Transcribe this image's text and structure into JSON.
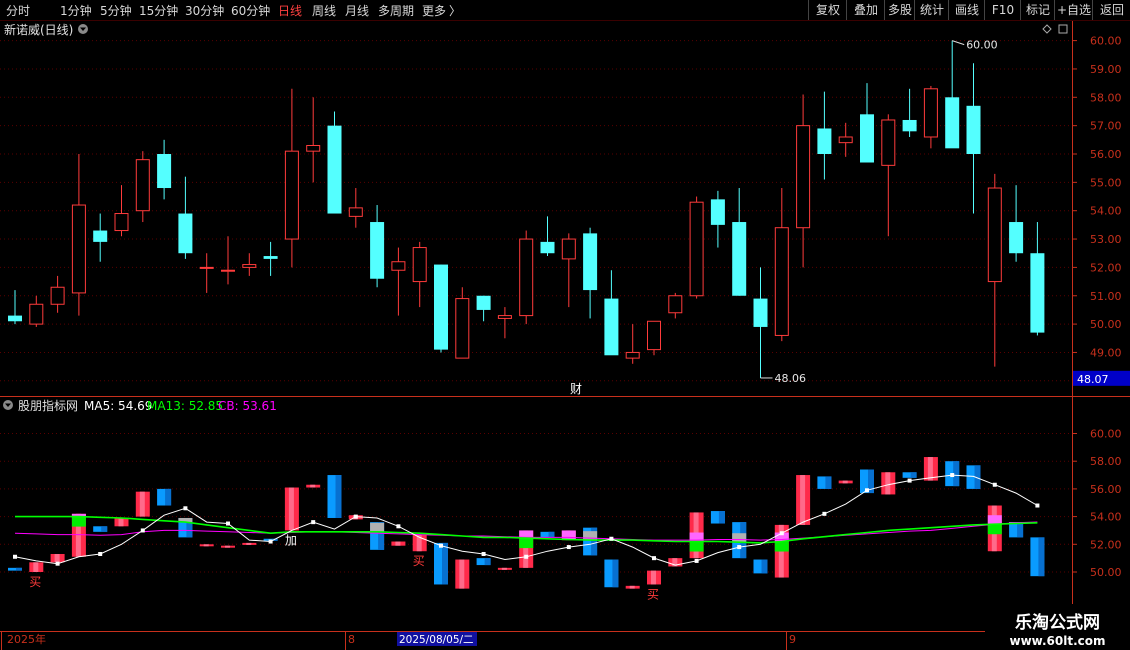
{
  "toolbar": {
    "periods": [
      "分时",
      "1分钟",
      "5分钟",
      "15分钟",
      "30分钟",
      "60分钟",
      "日线",
      "周线",
      "月线",
      "多周期",
      "更多"
    ],
    "active_period": "日线",
    "more_arrow": "〉",
    "right_buttons": [
      "复权",
      "叠加",
      "多股",
      "统计",
      "画线",
      "F10",
      "标记",
      "+自选",
      "返回"
    ]
  },
  "main_chart": {
    "title": "新诺威(日线)",
    "price_ticks": [
      "60.00",
      "59.00",
      "58.00",
      "57.00",
      "56.00",
      "55.00",
      "54.00",
      "53.00",
      "52.00",
      "51.00",
      "50.00",
      "49.00",
      "48.00"
    ],
    "current_price": "48.07",
    "max_label": "60.00",
    "min_label": "48.06",
    "event_marker": "财",
    "colors": {
      "up": "#ff3b3b",
      "down": "#54ffff",
      "grid": "#5a0000",
      "axis": "#c8301c"
    }
  },
  "indicator": {
    "name": "股朋指标网",
    "ma5_label": "MA5: 54.69",
    "ma13_label": "MA13: 52.85",
    "cb_label": "CB: 53.61",
    "ticks": [
      "60.00",
      "58.00",
      "56.00",
      "54.00",
      "52.00",
      "50.00"
    ],
    "signals": [
      {
        "text": "买",
        "i": 1
      },
      {
        "text": "加",
        "i": 13
      },
      {
        "text": "买",
        "i": 19
      },
      {
        "text": "买",
        "i": 30
      }
    ],
    "colors": {
      "ma5": "#ffffff",
      "ma13": "#00ff00",
      "cb": "#ff00ff",
      "red": "#ff2a4a",
      "blue": "#0a9bff"
    }
  },
  "time_axis": {
    "labels": [
      "2025年",
      "8",
      "2025/08/05/二",
      "9"
    ]
  },
  "watermark": {
    "title": "乐淘公式网",
    "url": "www.60lt.com"
  },
  "chart_data": {
    "type": "candlestick",
    "ylim": [
      47.6,
      60.6
    ],
    "candles": [
      {
        "o": 50.3,
        "h": 51.2,
        "l": 50.0,
        "c": 50.1
      },
      {
        "o": 50.0,
        "h": 51.0,
        "l": 49.9,
        "c": 50.7
      },
      {
        "o": 50.7,
        "h": 51.7,
        "l": 50.4,
        "c": 51.3
      },
      {
        "o": 51.1,
        "h": 56.0,
        "l": 50.3,
        "c": 54.2
      },
      {
        "o": 53.3,
        "h": 53.9,
        "l": 52.2,
        "c": 52.9
      },
      {
        "o": 53.3,
        "h": 54.9,
        "l": 53.1,
        "c": 53.9
      },
      {
        "o": 54.0,
        "h": 56.1,
        "l": 53.6,
        "c": 55.8
      },
      {
        "o": 56.0,
        "h": 56.5,
        "l": 54.4,
        "c": 54.8
      },
      {
        "o": 53.9,
        "h": 55.2,
        "l": 52.3,
        "c": 52.5
      },
      {
        "o": 52.0,
        "h": 52.5,
        "l": 51.1,
        "c": 52.0
      },
      {
        "o": 51.9,
        "h": 53.1,
        "l": 51.4,
        "c": 51.9
      },
      {
        "o": 52.0,
        "h": 52.5,
        "l": 51.7,
        "c": 52.1
      },
      {
        "o": 52.4,
        "h": 52.9,
        "l": 51.7,
        "c": 52.3
      },
      {
        "o": 53.0,
        "h": 58.3,
        "l": 52.0,
        "c": 56.1
      },
      {
        "o": 56.1,
        "h": 58.0,
        "l": 55.0,
        "c": 56.3
      },
      {
        "o": 57.0,
        "h": 57.5,
        "l": 53.9,
        "c": 53.9
      },
      {
        "o": 53.8,
        "h": 54.8,
        "l": 53.4,
        "c": 54.1
      },
      {
        "o": 53.6,
        "h": 54.2,
        "l": 51.3,
        "c": 51.6
      },
      {
        "o": 51.9,
        "h": 52.7,
        "l": 50.3,
        "c": 52.2
      },
      {
        "o": 51.5,
        "h": 52.9,
        "l": 50.6,
        "c": 52.7
      },
      {
        "o": 52.1,
        "h": 52.1,
        "l": 49.0,
        "c": 49.1
      },
      {
        "o": 48.8,
        "h": 51.3,
        "l": 48.8,
        "c": 50.9
      },
      {
        "o": 51.0,
        "h": 51.0,
        "l": 50.1,
        "c": 50.5
      },
      {
        "o": 50.2,
        "h": 50.6,
        "l": 49.5,
        "c": 50.3
      },
      {
        "o": 50.3,
        "h": 53.3,
        "l": 50.0,
        "c": 53.0
      },
      {
        "o": 52.9,
        "h": 53.8,
        "l": 52.4,
        "c": 52.5
      },
      {
        "o": 52.3,
        "h": 53.2,
        "l": 50.6,
        "c": 53.0
      },
      {
        "o": 53.2,
        "h": 53.4,
        "l": 50.2,
        "c": 51.2
      },
      {
        "o": 50.9,
        "h": 51.9,
        "l": 49.0,
        "c": 48.9
      },
      {
        "o": 48.8,
        "h": 50.0,
        "l": 48.6,
        "c": 49.0
      },
      {
        "o": 49.1,
        "h": 50.1,
        "l": 48.9,
        "c": 50.1
      },
      {
        "o": 50.4,
        "h": 51.1,
        "l": 50.2,
        "c": 51.0
      },
      {
        "o": 51.0,
        "h": 54.5,
        "l": 50.9,
        "c": 54.3
      },
      {
        "o": 54.4,
        "h": 54.7,
        "l": 52.7,
        "c": 53.5
      },
      {
        "o": 53.6,
        "h": 54.8,
        "l": 51.0,
        "c": 51.0
      },
      {
        "o": 50.9,
        "h": 52.0,
        "l": 48.1,
        "c": 49.9
      },
      {
        "o": 49.6,
        "h": 54.8,
        "l": 49.4,
        "c": 53.4
      },
      {
        "o": 53.4,
        "h": 58.1,
        "l": 52.0,
        "c": 57.0
      },
      {
        "o": 56.9,
        "h": 58.2,
        "l": 55.1,
        "c": 56.0
      },
      {
        "o": 56.4,
        "h": 57.1,
        "l": 55.9,
        "c": 56.6
      },
      {
        "o": 57.4,
        "h": 58.5,
        "l": 55.7,
        "c": 55.7
      },
      {
        "o": 55.6,
        "h": 57.4,
        "l": 53.1,
        "c": 57.2
      },
      {
        "o": 57.2,
        "h": 58.3,
        "l": 56.6,
        "c": 56.8
      },
      {
        "o": 56.6,
        "h": 58.4,
        "l": 56.2,
        "c": 58.3
      },
      {
        "o": 58.0,
        "h": 60.0,
        "l": 56.4,
        "c": 56.2
      },
      {
        "o": 57.7,
        "h": 59.2,
        "l": 53.9,
        "c": 56.0
      },
      {
        "o": 51.5,
        "h": 55.3,
        "l": 48.5,
        "c": 54.8
      },
      {
        "o": 53.6,
        "h": 54.9,
        "l": 52.2,
        "c": 52.5
      },
      {
        "o": 52.5,
        "h": 53.6,
        "l": 49.6,
        "c": 49.7
      }
    ],
    "ma5": [
      51.1,
      50.8,
      50.6,
      51.1,
      51.3,
      52.0,
      53.0,
      54.1,
      54.6,
      53.6,
      53.5,
      52.3,
      52.2,
      53.0,
      53.6,
      53.1,
      54.0,
      53.9,
      53.3,
      52.5,
      51.9,
      51.5,
      51.3,
      50.9,
      51.1,
      51.5,
      51.8,
      52.0,
      52.4,
      51.8,
      51.0,
      50.5,
      50.8,
      51.4,
      51.8,
      52.0,
      52.8,
      53.6,
      54.2,
      54.9,
      55.9,
      56.3,
      56.6,
      56.8,
      57.0,
      56.9,
      56.3,
      55.7,
      54.8
    ],
    "ma13": [
      54.0,
      54.0,
      54.0,
      54.0,
      53.95,
      53.9,
      53.8,
      53.7,
      53.6,
      53.4,
      53.2,
      53.0,
      52.8,
      52.9,
      52.9,
      52.9,
      52.9,
      52.9,
      52.85,
      52.8,
      52.7,
      52.6,
      52.5,
      52.5,
      52.45,
      52.4,
      52.35,
      52.3,
      52.3,
      52.3,
      52.25,
      52.2,
      52.2,
      52.2,
      52.15,
      52.1,
      52.2,
      52.4,
      52.55,
      52.7,
      52.85,
      53.0,
      53.1,
      53.2,
      53.3,
      53.4,
      53.45,
      53.5,
      53.55
    ],
    "cb": [
      52.8,
      52.75,
      52.7,
      52.7,
      52.65,
      52.7,
      52.9,
      53.0,
      53.0,
      52.95,
      52.9,
      52.85,
      52.8,
      52.85,
      52.9,
      52.9,
      52.85,
      52.8,
      52.75,
      52.7,
      52.65,
      52.6,
      52.6,
      52.55,
      52.5,
      52.5,
      52.5,
      52.45,
      52.4,
      52.35,
      52.3,
      52.3,
      52.3,
      52.35,
      52.35,
      52.3,
      52.35,
      52.45,
      52.55,
      52.65,
      52.75,
      52.85,
      52.95,
      53.0,
      53.15,
      53.3,
      53.45,
      53.55,
      53.61
    ]
  }
}
